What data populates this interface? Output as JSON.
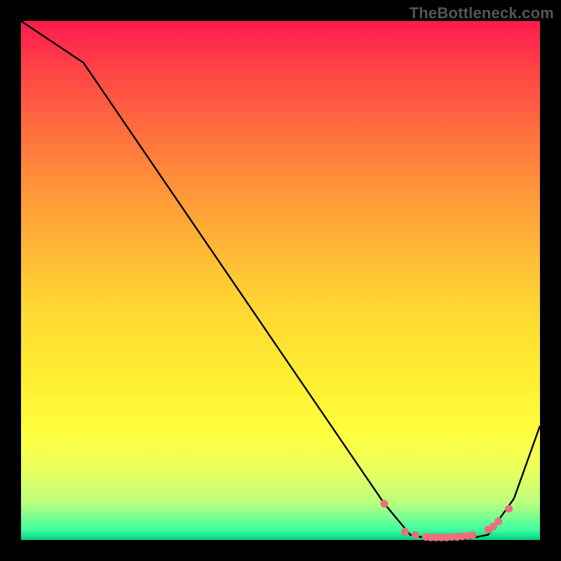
{
  "watermark": "TheBottleneck.com",
  "chart_data": {
    "type": "line",
    "title": "",
    "xlabel": "",
    "ylabel": "",
    "xlim": [
      0,
      100
    ],
    "ylim": [
      0,
      100
    ],
    "series": [
      {
        "name": "bottleneck-curve",
        "x": [
          0,
          12,
          70,
          75,
          80,
          85,
          90,
          95,
          100
        ],
        "values": [
          100,
          92,
          7,
          1,
          0,
          0,
          1,
          8,
          22
        ]
      }
    ],
    "markers": {
      "name": "highlight-points",
      "x": [
        70,
        74,
        76,
        78,
        79,
        80,
        81,
        82,
        83,
        84,
        85,
        86,
        87,
        90,
        91,
        92,
        94
      ],
      "values": [
        7,
        1.6,
        1,
        0.6,
        0.5,
        0.5,
        0.5,
        0.5,
        0.6,
        0.6,
        0.7,
        0.8,
        0.9,
        2.0,
        2.6,
        3.6,
        6.0
      ]
    },
    "gradient_stops": [
      {
        "pos": 0,
        "color": "#ff1a4d"
      },
      {
        "pos": 8,
        "color": "#ff3e48"
      },
      {
        "pos": 20,
        "color": "#ff6a3f"
      },
      {
        "pos": 30,
        "color": "#ff8d3a"
      },
      {
        "pos": 42,
        "color": "#ffb236"
      },
      {
        "pos": 55,
        "color": "#ffd733"
      },
      {
        "pos": 70,
        "color": "#fff030"
      },
      {
        "pos": 80,
        "color": "#ffff40"
      },
      {
        "pos": 87,
        "color": "#e8ff60"
      },
      {
        "pos": 93,
        "color": "#b8ff80"
      },
      {
        "pos": 98,
        "color": "#40ffa0"
      },
      {
        "pos": 100,
        "color": "#00d080"
      }
    ],
    "marker_color": "#e9707d",
    "line_color": "#000000"
  }
}
